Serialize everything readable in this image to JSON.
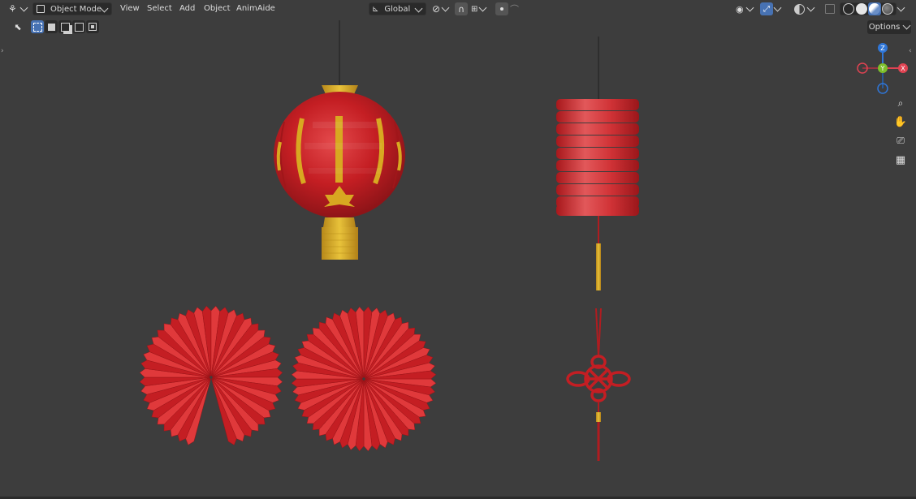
{
  "header": {
    "editor_type_icon": "editor-type-icon",
    "mode_label": "Object Mode",
    "menus": [
      "View",
      "Select",
      "Add",
      "Object",
      "AnimAide"
    ],
    "orientation_label": "Global",
    "icons": {
      "pivot": "pivot-icon",
      "snap": "snap-icon",
      "snap_target": "snap-target-icon",
      "proportional": "proportional-edit-icon",
      "visibility": "visibility-icon",
      "gizmo": "gizmo-icon",
      "overlay": "overlay-icon",
      "xray": "xray-icon"
    },
    "shading_modes": [
      "wireframe",
      "solid",
      "material-preview",
      "rendered"
    ],
    "active_shading": "material-preview"
  },
  "toolbar": {
    "options_label": "Options",
    "select_modes": [
      "select-box",
      "select-new",
      "select-extend",
      "select-subtract",
      "select-intersect"
    ]
  },
  "gizmo": {
    "axes": {
      "z": "Z",
      "y": "Y",
      "x": "X"
    },
    "colors": {
      "x": "#e04352",
      "y": "#7dbf2b",
      "z": "#2f76d8"
    }
  },
  "nav_icons": [
    "zoom-icon",
    "pan-hand-icon",
    "camera-icon",
    "grid-ortho-icon"
  ],
  "scene": {
    "objects": [
      "round-lantern",
      "cylinder-lantern",
      "paper-fan-open",
      "paper-fan-round",
      "chinese-knot"
    ],
    "colors": {
      "red": "#c41e23",
      "gold": "#d8a821",
      "background": "#3d3d3d"
    }
  }
}
